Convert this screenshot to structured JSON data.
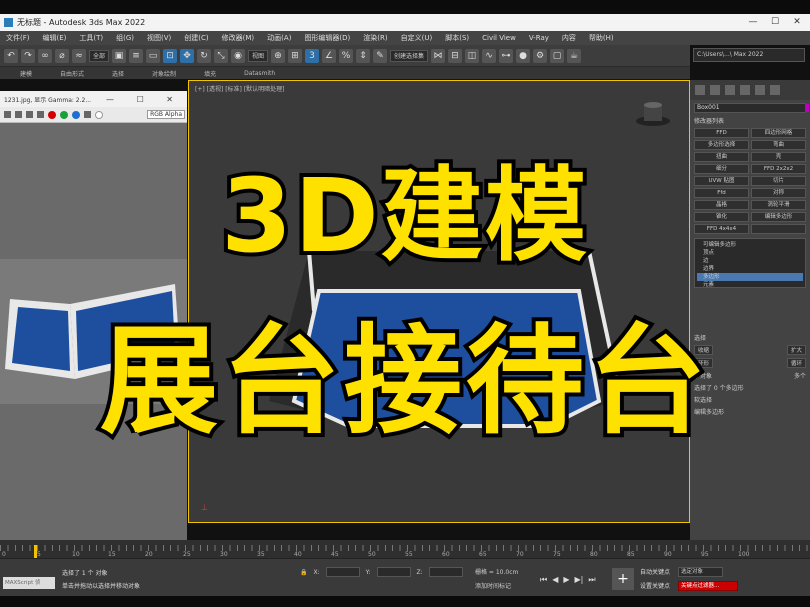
{
  "window": {
    "title": "无标题 - Autodesk 3ds Max 2022",
    "controls": [
      "—",
      "☐",
      "✕"
    ]
  },
  "menu": [
    "文件(F)",
    "编辑(E)",
    "工具(T)",
    "组(G)",
    "视图(V)",
    "创建(C)",
    "修改器(M)",
    "动画(A)",
    "图形编辑器(D)",
    "渲染(R)",
    "自定义(U)",
    "脚本(S)",
    "Civil View",
    "V-Ray",
    "内容",
    "帮助(H)"
  ],
  "toolbar": {
    "filter_select": "全部",
    "view_select": "视图",
    "selection_set": "创建选择集",
    "path": "C:\\Users\\...\\ Max 2022"
  },
  "ribbon": [
    "建模",
    "自由形式",
    "选择",
    "对象绘制",
    "填充",
    "Datasmith"
  ],
  "viewport": {
    "label": "[+] [透视] [标准] [默认明暗处理]"
  },
  "float_window": {
    "title": "1231.jpg, 显示 Gamma: 2.2...",
    "controls": "— ☐ ✕",
    "channel": "RGB Alpha",
    "swatch_colors": [
      "#d40000",
      "#1a9f3a",
      "#1f6fd0"
    ]
  },
  "right_panel": {
    "object_name": "Box001",
    "modifier_list": "修改器列表",
    "modifiers": [
      "FFD",
      "四边形网格",
      "多边形选择",
      "弯曲",
      "扭曲",
      "壳",
      "细分",
      "FFD 2x2x2",
      "UVW 贴图",
      "切片",
      "Ffd",
      "对称",
      "晶格",
      "涡轮平滑",
      "锥化",
      "编辑多边形",
      "FFD 4x4x4",
      ""
    ],
    "stack": [
      "可编辑多边形",
      "顶点",
      "边",
      "边界",
      "多边形",
      "元素"
    ],
    "stack_selected": 4,
    "lower": {
      "row1": "选择",
      "row2_a": "收缩",
      "row2_b": "扩大",
      "row3": "环形",
      "row4": "循环",
      "radio": "子对象",
      "radio2": "多个",
      "selected_info": "选择了 0 个多边形",
      "soft_sel": "软选择",
      "edit_poly": "编辑多边形"
    }
  },
  "timeline": {
    "ticks": [
      "0",
      "5",
      "10",
      "15",
      "20",
      "25",
      "30",
      "35",
      "40",
      "45",
      "50",
      "55",
      "60",
      "65",
      "70",
      "75",
      "80",
      "85",
      "90",
      "95",
      "100"
    ],
    "current_frame": "0 / 100"
  },
  "status": {
    "maxscript": "MAXScript 侦",
    "line1": "选择了 1 个 对象",
    "line2": "单击并拖动以选择并移动对象",
    "x_label": "X:",
    "y_label": "Y:",
    "z_label": "Z:",
    "grid": "栅格 = 10.0cm",
    "add_time": "添加时间标记",
    "auto_key": "自动关键点",
    "set_key": "设置关键点",
    "sel_set": "选定对象",
    "key_filter": "关键点过滤器..."
  },
  "overlay": {
    "line1": "3D建模",
    "line2": "展台接待台"
  },
  "colors": {
    "overlay_fill": "#ffe100",
    "overlay_stroke": "#000000",
    "viewport_border": "#f3c200",
    "booth_blue": "#1e4f9e"
  }
}
